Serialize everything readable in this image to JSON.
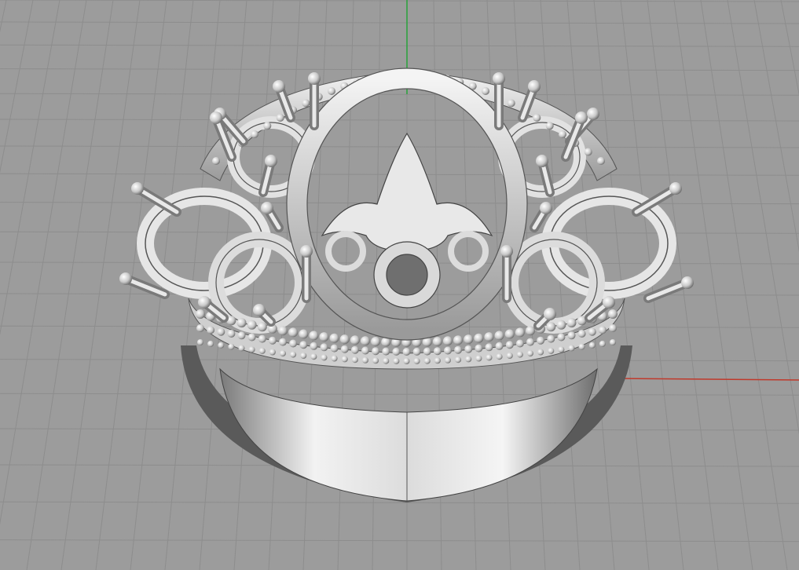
{
  "viewport": {
    "background": "#9c9c9c",
    "grid_minor_color": "#8d8d8d",
    "grid_major_color": "#7f7f7f",
    "x_axis_color": "#c0392b",
    "y_axis_color": "#27a33a",
    "display_mode": "rendered"
  },
  "model": {
    "subject": "ring",
    "material_color": "#d8d8d8",
    "icon": "ring-3d-model"
  }
}
